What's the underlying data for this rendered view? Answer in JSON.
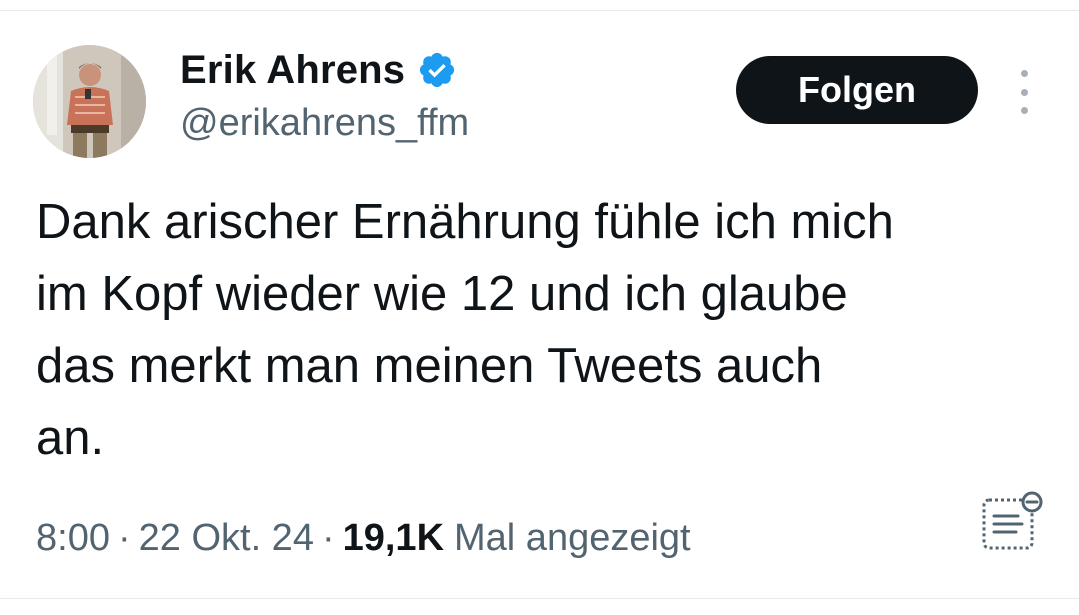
{
  "author": {
    "display_name": "Erik Ahrens",
    "handle": "@erikahrens_ffm",
    "verified": true,
    "verified_color": "#1d9bf0",
    "avatar_icon": "profile-photo"
  },
  "follow_button": {
    "label": "Folgen"
  },
  "more_menu": {
    "icon": "more-vertical-icon"
  },
  "tweet": {
    "text": "Dank arischer Ernährung fühle ich mich\nim Kopf wieder wie 12 und ich glaube\ndas merkt man meinen Tweets auch\nan."
  },
  "meta": {
    "time": "8:00",
    "separator": "·",
    "date": "22 Okt. 24",
    "views_count": "19,1K",
    "views_label": "Mal angezeigt"
  },
  "views_icon": {
    "icon": "note-list-icon"
  },
  "colors": {
    "primary_text": "#0f1419",
    "secondary_text": "#536471",
    "button_bg": "#0f1419",
    "divider": "#e7e9ea"
  }
}
